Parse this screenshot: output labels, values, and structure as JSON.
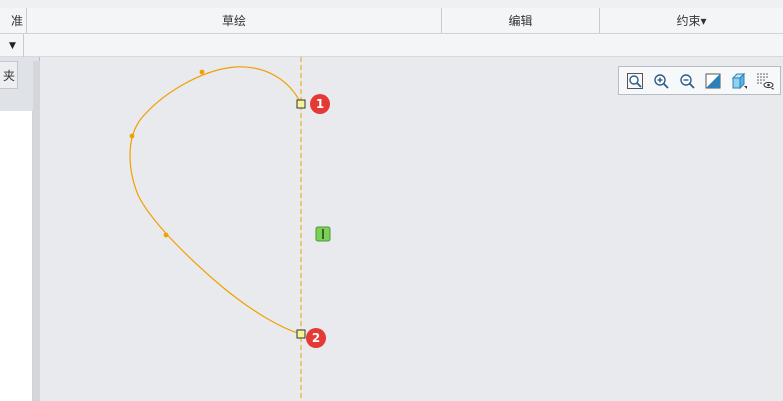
{
  "ribbon": {
    "groups": [
      {
        "label": "准"
      },
      {
        "label": "草绘"
      },
      {
        "label": "编辑"
      },
      {
        "label": "约束▾"
      }
    ]
  },
  "left_panel": {
    "tab_label": "夹"
  },
  "view_toolbar": {
    "icons": [
      "zoom-fit-icon",
      "zoom-in-icon",
      "zoom-out-icon",
      "repaint-icon",
      "display-style-icon",
      "sketch-display-icon"
    ]
  },
  "sketch": {
    "curve_color": "#f0a000",
    "centerline_color": "#f0a000",
    "badges": [
      {
        "label": "1"
      },
      {
        "label": "2"
      }
    ]
  }
}
